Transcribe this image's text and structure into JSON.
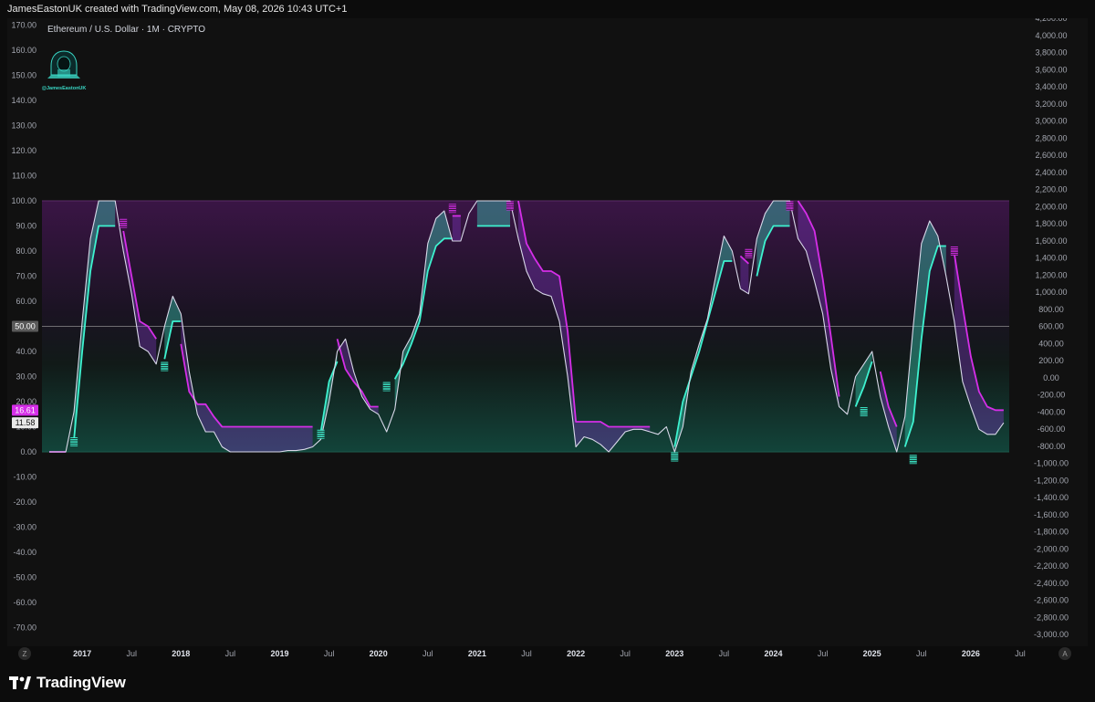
{
  "header": {
    "attribution": "JamesEastonUK created with TradingView.com, May 08, 2026 10:43 UTC+1"
  },
  "footer": {
    "brand": "TradingView"
  },
  "watermark": {
    "handle": "@JamesEastonUK"
  },
  "scale_buttons": {
    "left": "Z",
    "right": "A"
  },
  "colors": {
    "background": "#111111",
    "cyan": "#3ef2d0",
    "magenta": "#d52ee8",
    "white_line": "#d8d8e8",
    "midline": "#a8a8a8",
    "badge_magenta": "#d52ee8",
    "badge_white": "#e8e8e8"
  },
  "chart_data": {
    "type": "line",
    "title": "Ethereum / U.S. Dollar · 1M · CRYPTO",
    "left_axis": {
      "ylim": [
        -75,
        172
      ],
      "ticks": [
        "170.00",
        "160.00",
        "150.00",
        "140.00",
        "130.00",
        "120.00",
        "110.00",
        "100.00",
        "90.00",
        "80.00",
        "70.00",
        "60.00",
        "50.00",
        "40.00",
        "30.00",
        "20.00",
        "10.00",
        "0.00",
        "-10.00",
        "-20.00",
        "-30.00",
        "-40.00",
        "-50.00",
        "-60.00",
        "-70.00"
      ]
    },
    "right_axis": {
      "ticks": [
        "4,200.00",
        "4,000.00",
        "3,800.00",
        "3,600.00",
        "3,400.00",
        "3,200.00",
        "3,000.00",
        "2,800.00",
        "2,600.00",
        "2,400.00",
        "2,200.00",
        "2,000.00",
        "1,800.00",
        "1,600.00",
        "1,400.00",
        "1,200.00",
        "1,000.00",
        "800.00",
        "600.00",
        "400.00",
        "200.00",
        "0.00",
        "-200.00",
        "-400.00",
        "-600.00",
        "-800.00",
        "-1,000.00",
        "-1,200.00",
        "-1,400.00",
        "-1,600.00",
        "-1,800.00",
        "-2,000.00",
        "-2,200.00",
        "-2,400.00",
        "-2,600.00",
        "-2,800.00",
        "-3,000.00"
      ]
    },
    "x_axis": {
      "range": [
        "2016-07",
        "2026-09"
      ],
      "ticks": [
        {
          "t": "2017-01",
          "label": "2017",
          "bold": true
        },
        {
          "t": "2017-07",
          "label": "Jul",
          "bold": false
        },
        {
          "t": "2018-01",
          "label": "2018",
          "bold": true
        },
        {
          "t": "2018-07",
          "label": "Jul",
          "bold": false
        },
        {
          "t": "2019-01",
          "label": "2019",
          "bold": true
        },
        {
          "t": "2019-07",
          "label": "Jul",
          "bold": false
        },
        {
          "t": "2020-01",
          "label": "2020",
          "bold": true
        },
        {
          "t": "2020-07",
          "label": "Jul",
          "bold": false
        },
        {
          "t": "2021-01",
          "label": "2021",
          "bold": true
        },
        {
          "t": "2021-07",
          "label": "Jul",
          "bold": false
        },
        {
          "t": "2022-01",
          "label": "2022",
          "bold": true
        },
        {
          "t": "2022-07",
          "label": "Jul",
          "bold": false
        },
        {
          "t": "2023-01",
          "label": "2023",
          "bold": true
        },
        {
          "t": "2023-07",
          "label": "Jul",
          "bold": false
        },
        {
          "t": "2024-01",
          "label": "2024",
          "bold": true
        },
        {
          "t": "2024-07",
          "label": "Jul",
          "bold": false
        },
        {
          "t": "2025-01",
          "label": "2025",
          "bold": true
        },
        {
          "t": "2025-07",
          "label": "Jul",
          "bold": false
        },
        {
          "t": "2026-01",
          "label": "2026",
          "bold": true
        },
        {
          "t": "2026-07",
          "label": "Jul",
          "bold": false
        }
      ]
    },
    "bands": {
      "upper": 100,
      "lower": 0,
      "mid": 50
    },
    "badges": [
      {
        "value": "50.00",
        "at": 50,
        "kind": "mid"
      },
      {
        "value": "16.61",
        "at": 16.61,
        "kind": "magenta"
      },
      {
        "value": "11.58",
        "at": 11.58,
        "kind": "white"
      }
    ],
    "series": [
      {
        "kind": "white",
        "x": [
          "2016-09",
          "2016-10",
          "2016-11",
          "2016-12",
          "2017-01",
          "2017-02",
          "2017-03",
          "2017-04",
          "2017-05",
          "2017-06",
          "2017-07",
          "2017-08",
          "2017-09",
          "2017-10",
          "2017-11",
          "2017-12",
          "2018-01",
          "2018-02",
          "2018-03",
          "2018-04",
          "2018-05",
          "2018-06",
          "2018-07",
          "2018-08",
          "2018-09",
          "2018-10",
          "2018-11",
          "2018-12",
          "2019-01",
          "2019-02",
          "2019-03",
          "2019-04",
          "2019-05",
          "2019-06",
          "2019-07",
          "2019-08",
          "2019-09",
          "2019-10",
          "2019-11",
          "2019-12",
          "2020-01",
          "2020-02",
          "2020-03",
          "2020-04",
          "2020-05",
          "2020-06",
          "2020-07",
          "2020-08",
          "2020-09",
          "2020-10",
          "2020-11",
          "2020-12",
          "2021-01",
          "2021-02",
          "2021-03",
          "2021-04",
          "2021-05",
          "2021-06",
          "2021-07",
          "2021-08",
          "2021-09",
          "2021-10",
          "2021-11",
          "2021-12",
          "2022-01",
          "2022-02",
          "2022-03",
          "2022-04",
          "2022-05",
          "2022-06",
          "2022-07",
          "2022-08",
          "2022-09",
          "2022-10",
          "2022-11",
          "2022-12",
          "2023-01",
          "2023-02",
          "2023-03",
          "2023-04",
          "2023-05",
          "2023-06",
          "2023-07",
          "2023-08",
          "2023-09",
          "2023-10",
          "2023-11",
          "2023-12",
          "2024-01",
          "2024-02",
          "2024-03",
          "2024-04",
          "2024-05",
          "2024-06",
          "2024-07",
          "2024-08",
          "2024-09",
          "2024-10",
          "2024-11",
          "2024-12",
          "2025-01",
          "2025-02",
          "2025-03",
          "2025-04",
          "2025-05",
          "2025-06",
          "2025-07",
          "2025-08",
          "2025-09",
          "2025-10",
          "2025-11",
          "2025-12",
          "2026-01",
          "2026-02",
          "2026-03",
          "2026-04",
          "2026-05"
        ],
        "y": [
          0,
          0,
          0,
          16,
          52,
          85,
          100,
          100,
          100,
          80,
          63,
          42,
          40,
          35,
          50,
          62,
          55,
          32,
          15,
          8,
          8,
          2,
          0,
          0,
          0,
          0,
          0,
          0,
          0,
          0.5,
          0.5,
          1,
          2,
          5,
          20,
          40,
          45,
          32,
          22,
          17,
          15,
          8,
          17,
          40,
          46,
          55,
          83,
          93,
          96,
          84,
          84,
          95,
          100,
          100,
          100,
          100,
          100,
          85,
          72,
          65,
          63,
          62,
          52,
          30,
          2,
          6,
          5,
          3,
          0,
          4,
          8,
          9,
          9,
          8,
          7,
          10,
          0,
          10,
          32,
          43,
          53,
          70,
          86,
          80,
          65,
          63,
          85,
          95,
          100,
          100,
          100,
          85,
          80,
          68,
          55,
          33,
          18,
          15,
          30,
          35,
          40,
          22,
          10,
          0,
          14,
          50,
          83,
          92,
          86,
          70,
          52,
          28,
          18,
          9,
          7,
          7,
          11.58
        ]
      },
      {
        "kind": "cyan",
        "x": [
          "2016-11",
          "2016-12",
          "2017-01",
          "2017-02",
          "2017-03",
          "2017-04",
          "2017-05",
          "2017-06",
          "2017-07",
          "2017-08",
          "2017-09",
          "2017-10",
          "2017-11",
          "2017-12",
          "2018-01",
          "2018-02",
          "2018-03",
          "2018-04",
          "2018-05",
          "2018-06",
          "2018-07",
          "2018-08",
          "2018-09",
          "2018-10",
          "2018-11",
          "2018-12",
          "2019-01",
          "2019-02",
          "2019-03",
          "2019-04",
          "2019-05",
          "2019-06",
          "2019-07",
          "2019-08",
          "2019-09",
          "2019-10",
          "2019-11",
          "2019-12",
          "2020-01",
          "2020-02",
          "2020-03",
          "2020-04",
          "2020-05",
          "2020-06",
          "2020-07",
          "2020-08",
          "2020-09",
          "2020-10",
          "2020-11",
          "2020-12",
          "2021-01",
          "2021-02",
          "2021-03",
          "2021-04",
          "2021-05",
          "2021-06",
          "2021-07",
          "2021-08",
          "2021-09",
          "2021-10",
          "2021-11",
          "2021-12",
          "2022-01",
          "2022-02",
          "2022-03",
          "2022-04",
          "2022-05",
          "2022-06",
          "2022-07",
          "2022-08",
          "2022-09",
          "2022-10",
          "2022-11",
          "2022-12",
          "2023-01",
          "2023-02",
          "2023-03",
          "2023-04",
          "2023-05",
          "2023-06",
          "2023-07",
          "2023-08",
          "2023-09",
          "2023-10",
          "2023-11",
          "2023-12",
          "2024-01",
          "2024-02",
          "2024-03",
          "2024-04",
          "2024-05",
          "2024-06",
          "2024-07",
          "2024-08",
          "2024-09",
          "2024-10",
          "2024-11",
          "2024-12",
          "2025-01",
          "2025-02",
          "2025-03",
          "2025-04",
          "2025-05",
          "2025-06",
          "2025-07",
          "2025-08",
          "2025-09",
          "2025-10",
          "2025-11",
          "2025-12",
          "2026-01",
          "2026-02",
          "2026-03",
          "2026-04",
          "2026-05"
        ],
        "y": [
          null,
          5,
          40,
          72,
          90,
          90,
          90,
          null,
          null,
          null,
          null,
          null,
          37,
          52,
          52,
          null,
          null,
          null,
          null,
          null,
          null,
          null,
          null,
          null,
          null,
          null,
          null,
          null,
          null,
          null,
          null,
          8,
          28,
          36,
          null,
          null,
          null,
          null,
          null,
          null,
          29,
          35,
          43,
          52,
          72,
          82,
          85,
          85,
          null,
          null,
          90,
          90,
          90,
          90,
          90,
          null,
          null,
          null,
          null,
          null,
          null,
          null,
          null,
          null,
          null,
          null,
          null,
          null,
          null,
          null,
          null,
          null,
          null,
          null,
          2,
          20,
          30,
          40,
          52,
          64,
          76,
          76,
          null,
          null,
          70,
          84,
          90,
          90,
          90,
          null,
          null,
          null,
          null,
          null,
          null,
          null,
          18,
          26,
          36,
          null,
          null,
          null,
          2,
          12,
          45,
          72,
          82,
          82,
          null,
          null,
          null,
          null,
          null,
          null,
          null
        ]
      },
      {
        "kind": "magenta",
        "x": [
          "2016-09",
          "2016-10",
          "2016-11",
          "2016-12",
          "2017-01",
          "2017-02",
          "2017-03",
          "2017-04",
          "2017-05",
          "2017-06",
          "2017-07",
          "2017-08",
          "2017-09",
          "2017-10",
          "2017-11",
          "2017-12",
          "2018-01",
          "2018-02",
          "2018-03",
          "2018-04",
          "2018-05",
          "2018-06",
          "2018-07",
          "2018-08",
          "2018-09",
          "2018-10",
          "2018-11",
          "2018-12",
          "2019-01",
          "2019-02",
          "2019-03",
          "2019-04",
          "2019-05",
          "2019-06",
          "2019-07",
          "2019-08",
          "2019-09",
          "2019-10",
          "2019-11",
          "2019-12",
          "2020-01",
          "2020-02",
          "2020-03",
          "2020-04",
          "2020-05",
          "2020-06",
          "2020-07",
          "2020-08",
          "2020-09",
          "2020-10",
          "2020-11",
          "2020-12",
          "2021-01",
          "2021-02",
          "2021-03",
          "2021-04",
          "2021-05",
          "2021-06",
          "2021-07",
          "2021-08",
          "2021-09",
          "2021-10",
          "2021-11",
          "2021-12",
          "2022-01",
          "2022-02",
          "2022-03",
          "2022-04",
          "2022-05",
          "2022-06",
          "2022-07",
          "2022-08",
          "2022-09",
          "2022-10",
          "2022-11",
          "2022-12",
          "2023-01",
          "2023-02",
          "2023-03",
          "2023-04",
          "2023-05",
          "2023-06",
          "2023-07",
          "2023-08",
          "2023-09",
          "2023-10",
          "2023-11",
          "2023-12",
          "2024-01",
          "2024-02",
          "2024-03",
          "2024-04",
          "2024-05",
          "2024-06",
          "2024-07",
          "2024-08",
          "2024-09",
          "2024-10",
          "2024-11",
          "2024-12",
          "2025-01",
          "2025-02",
          "2025-03",
          "2025-04",
          "2025-05",
          "2025-06",
          "2025-07",
          "2025-08",
          "2025-09",
          "2025-10",
          "2025-11",
          "2025-12",
          "2026-01",
          "2026-02",
          "2026-03",
          "2026-04",
          "2026-05"
        ],
        "y": [
          0,
          0,
          0,
          null,
          null,
          null,
          null,
          null,
          null,
          88,
          70,
          52,
          50,
          45,
          null,
          null,
          43,
          24,
          19,
          19,
          14,
          10,
          10,
          10,
          10,
          10,
          10,
          10,
          10,
          10,
          10,
          10,
          10,
          null,
          null,
          45,
          33,
          28,
          24,
          18,
          18,
          null,
          null,
          null,
          null,
          null,
          null,
          null,
          null,
          94,
          94,
          null,
          null,
          null,
          null,
          null,
          null,
          100,
          83,
          77,
          72,
          72,
          70,
          48,
          12,
          12,
          12,
          12,
          10,
          10,
          10,
          10,
          10,
          10,
          null,
          null,
          null,
          null,
          null,
          null,
          null,
          null,
          null,
          null,
          78,
          75,
          null,
          null,
          null,
          null,
          null,
          100,
          95,
          88,
          69,
          46,
          22,
          null,
          null,
          null,
          null,
          32,
          18,
          10,
          null,
          null,
          null,
          null,
          null,
          null,
          79,
          58,
          38,
          24,
          18,
          16.61,
          16.61
        ]
      }
    ],
    "arrows": [
      {
        "t": "2016-12",
        "y": 4,
        "dir": "up"
      },
      {
        "t": "2017-11",
        "y": 34,
        "dir": "up"
      },
      {
        "t": "2019-06",
        "y": 7,
        "dir": "up"
      },
      {
        "t": "2020-02",
        "y": 26,
        "dir": "up"
      },
      {
        "t": "2023-01",
        "y": -2,
        "dir": "up"
      },
      {
        "t": "2024-12",
        "y": 16,
        "dir": "up"
      },
      {
        "t": "2025-06",
        "y": -3,
        "dir": "up"
      },
      {
        "t": "2017-06",
        "y": 91,
        "dir": "down"
      },
      {
        "t": "2020-10",
        "y": 97,
        "dir": "down"
      },
      {
        "t": "2021-05",
        "y": 98,
        "dir": "down"
      },
      {
        "t": "2023-10",
        "y": 79,
        "dir": "down"
      },
      {
        "t": "2024-03",
        "y": 98,
        "dir": "down"
      },
      {
        "t": "2025-11",
        "y": 80,
        "dir": "down"
      }
    ]
  }
}
